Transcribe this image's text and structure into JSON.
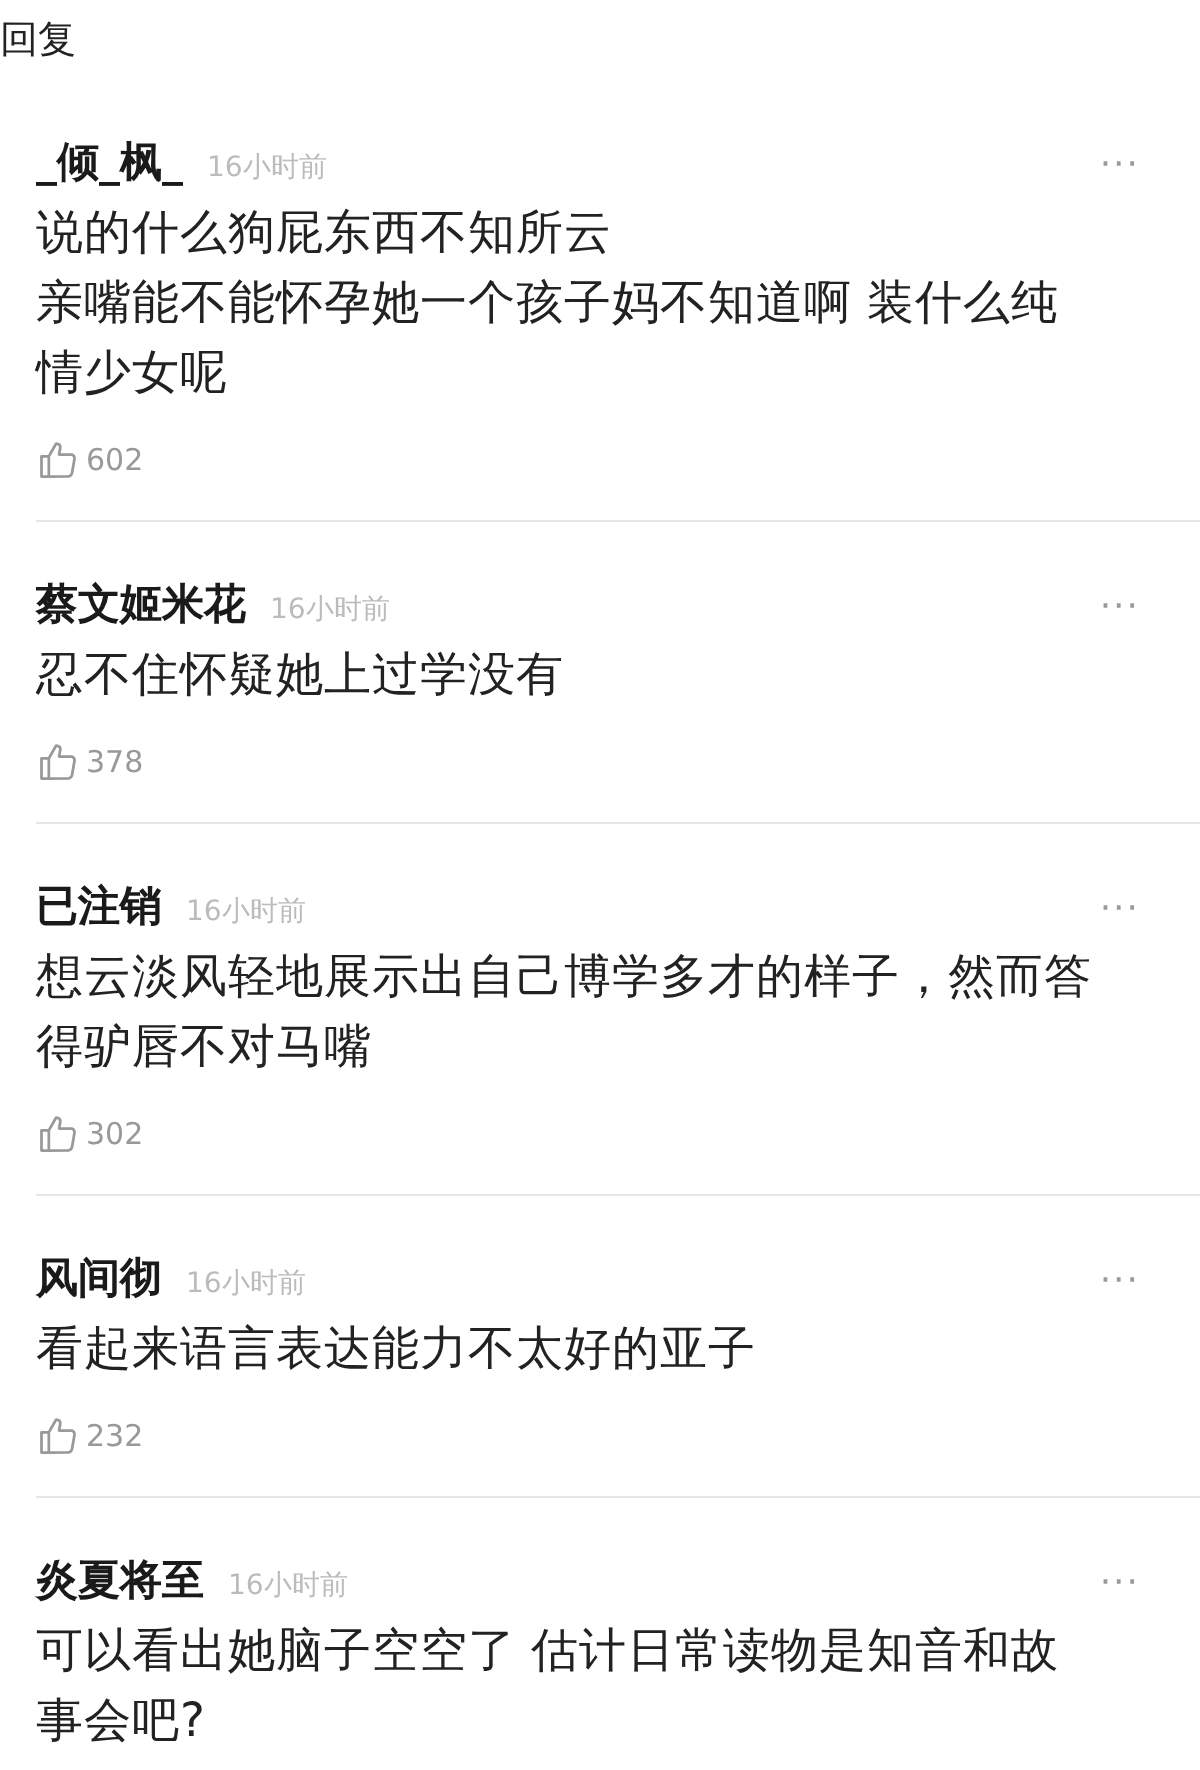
{
  "header": {
    "title": "回复"
  },
  "comments": [
    {
      "user": "_倾_枫_",
      "time": "16小时前",
      "more": "···",
      "text": [
        "说的什么狗屁东西不知所云",
        "亲嘴能不能怀孕她一个孩子妈不知道啊 装什么纯情少女呢"
      ],
      "likes": "602"
    },
    {
      "user": "蔡文姬米花",
      "time": "16小时前",
      "more": "···",
      "text": [
        "忍不住怀疑她上过学没有"
      ],
      "likes": "378"
    },
    {
      "user": "已注销",
      "time": "16小时前",
      "more": "···",
      "text": [
        "想云淡风轻地展示出自己博学多才的样子，然而答得驴唇不对马嘴"
      ],
      "likes": "302"
    },
    {
      "user": "风间彻",
      "time": "16小时前",
      "more": "···",
      "text": [
        "看起来语言表达能力不太好的亚子"
      ],
      "likes": "232"
    },
    {
      "user": "炎夏将至",
      "time": "16小时前",
      "more": "···",
      "text": [
        "可以看出她脑子空空了 估计日常读物是知音和故事会吧?"
      ]
    }
  ]
}
